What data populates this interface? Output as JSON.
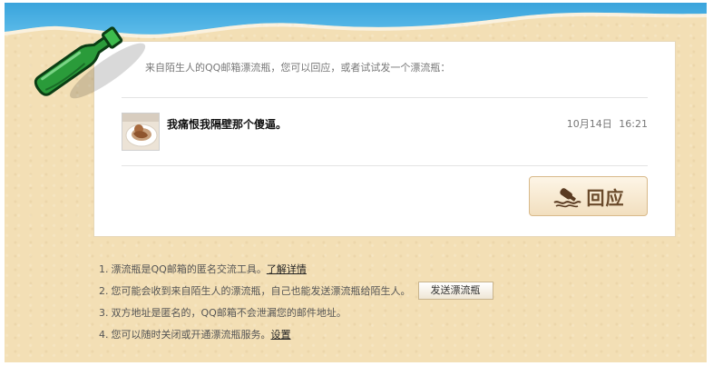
{
  "intro_text": "来自陌生人的QQ邮箱漂流瓶，您可以回应，或者试试发一个漂流瓶：",
  "message": {
    "text": "我痛恨我隔壁那个傻逼。",
    "time": "10月14日 16:21"
  },
  "reply_button": {
    "label": "回应",
    "icon": "bottle-wave-icon"
  },
  "notes": [
    {
      "number": "1.",
      "text": "漂流瓶是QQ邮箱的匿名交流工具。",
      "link": "了解详情"
    },
    {
      "number": "2.",
      "text": "您可能会收到来自陌生人的漂流瓶，自己也能发送漂流瓶给陌生人。",
      "button": "发送漂流瓶"
    },
    {
      "number": "3.",
      "text": "双方地址是匿名的，QQ邮箱不会泄漏您的邮件地址。"
    },
    {
      "number": "4.",
      "text": "您可以随时关闭或开通漂流瓶服务。",
      "link": "设置"
    }
  ],
  "colors": {
    "sky": "#47ade0",
    "sand": "#f3dfb5",
    "bottle_green": "#2a9b3a",
    "reply_text": "#6a4a2b"
  }
}
